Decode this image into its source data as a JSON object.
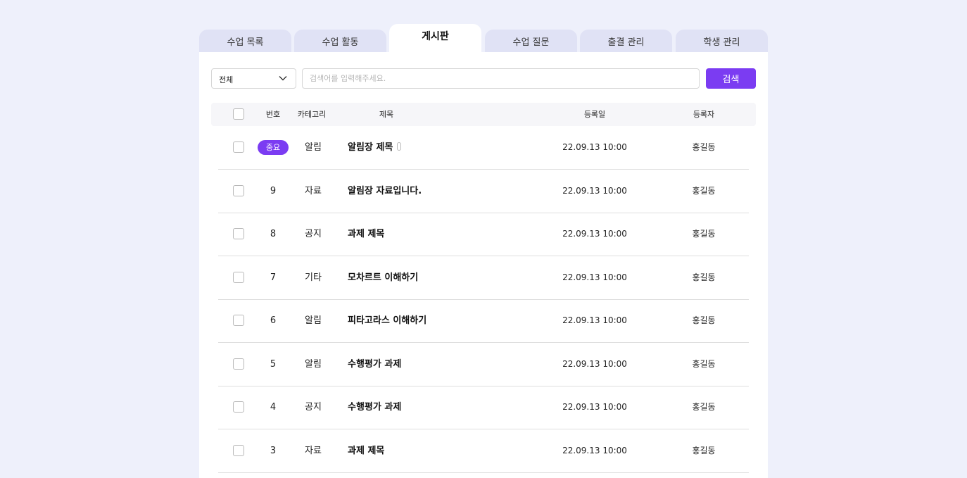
{
  "tabs": [
    {
      "label": "수업 목록",
      "active": false
    },
    {
      "label": "수업 활동",
      "active": false
    },
    {
      "label": "게시판",
      "active": true
    },
    {
      "label": "수업 질문",
      "active": false
    },
    {
      "label": "출결 관리",
      "active": false
    },
    {
      "label": "학생 관리",
      "active": false
    }
  ],
  "search": {
    "filter_value": "전체",
    "placeholder": "검색어를 입력해주세요.",
    "button_label": "검색"
  },
  "table": {
    "headers": {
      "number": "번호",
      "category": "카테고리",
      "title": "제목",
      "date": "등록일",
      "author": "등록자"
    },
    "rows": [
      {
        "number": "중요",
        "important": true,
        "category": "알림",
        "title": "알림장 제목",
        "attachment": true,
        "date": "22.09.13 10:00",
        "author": "홍길동"
      },
      {
        "number": "9",
        "important": false,
        "category": "자료",
        "title": "알림장 자료입니다.",
        "attachment": false,
        "date": "22.09.13 10:00",
        "author": "홍길동"
      },
      {
        "number": "8",
        "important": false,
        "category": "공지",
        "title": "과제 제목",
        "attachment": false,
        "date": "22.09.13 10:00",
        "author": "홍길동"
      },
      {
        "number": "7",
        "important": false,
        "category": "기타",
        "title": "모차르트 이해하기",
        "attachment": false,
        "date": "22.09.13 10:00",
        "author": "홍길동"
      },
      {
        "number": "6",
        "important": false,
        "category": "알림",
        "title": "피타고라스 이해하기",
        "attachment": false,
        "date": "22.09.13 10:00",
        "author": "홍길동"
      },
      {
        "number": "5",
        "important": false,
        "category": "알림",
        "title": "수행평가 과제",
        "attachment": false,
        "date": "22.09.13 10:00",
        "author": "홍길동"
      },
      {
        "number": "4",
        "important": false,
        "category": "공지",
        "title": "수행평가 과제",
        "attachment": false,
        "date": "22.09.13 10:00",
        "author": "홍길동"
      },
      {
        "number": "3",
        "important": false,
        "category": "자료",
        "title": "과제 제목",
        "attachment": false,
        "date": "22.09.13 10:00",
        "author": "홍길동"
      }
    ]
  },
  "colors": {
    "accent": "#7b3cf2",
    "page_background": "#eef0fb",
    "tab_inactive": "#e0e2f5"
  }
}
